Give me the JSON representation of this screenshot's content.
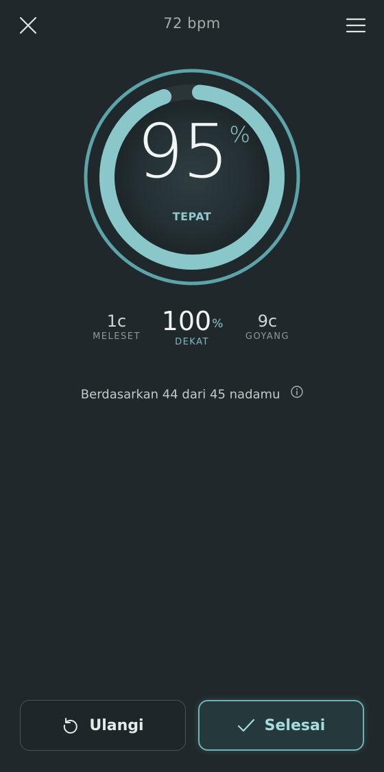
{
  "header": {
    "title": "72 bpm",
    "close_icon": "close-icon",
    "menu_icon": "hamburger-menu-icon"
  },
  "score": {
    "value": "95",
    "unit": "%",
    "label": "TEPAT",
    "ring_fraction": 0.95
  },
  "stats": {
    "miss": {
      "value": "1c",
      "label": "MELESET"
    },
    "near": {
      "value": "100",
      "unit": "%",
      "label": "DEKAT"
    },
    "wobble": {
      "value": "9c",
      "label": "GOYANG"
    }
  },
  "basis": {
    "text": "Berdasarkan 44 dari 45 nadamu",
    "info_icon": "info-icon"
  },
  "actions": {
    "retry_label": "Ulangi",
    "retry_icon": "undo-icon",
    "done_label": "Selesai",
    "done_icon": "check-icon"
  },
  "colors": {
    "background": "#20282b",
    "accent": "#8fc9cc",
    "ring_outer": "#5ba5aa"
  }
}
